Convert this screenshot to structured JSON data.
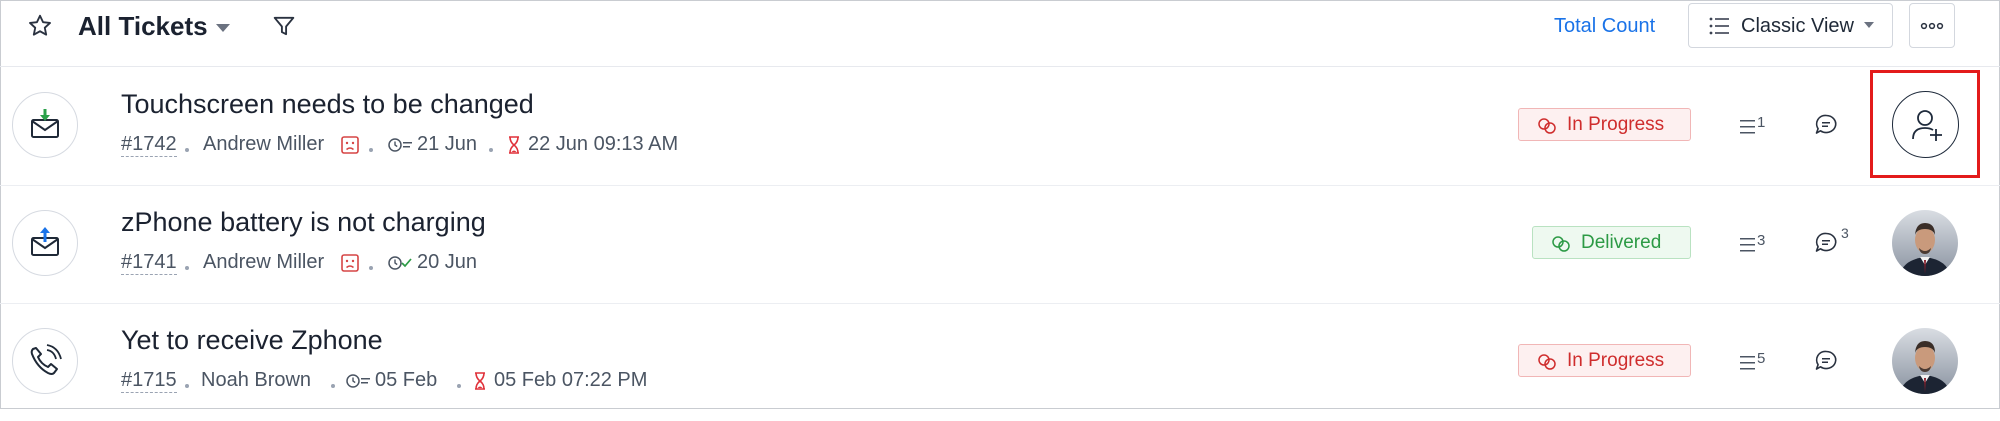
{
  "header": {
    "view_title": "All Tickets",
    "total_count_label": "Total Count",
    "view_mode_label": "Classic View"
  },
  "colors": {
    "link_blue": "#1a73e8",
    "in_progress_red": "#cf2d2d",
    "delivered_green": "#2c9a45",
    "highlight_red": "#e31b1b"
  },
  "tickets": [
    {
      "channel_icon": "email-incoming-icon",
      "subject": "Touchscreen needs to be changed",
      "number": "#1742",
      "contact": "Andrew Miller",
      "sentiment_icon": "sad-face-icon",
      "created": "21 Jun",
      "due": "22 Jun 09:13 AM",
      "status": "In Progress",
      "thread_count": "1",
      "comment_count": "",
      "assignee": "unassigned"
    },
    {
      "channel_icon": "email-outgoing-icon",
      "subject": "zPhone battery is not charging",
      "number": "#1741",
      "contact": "Andrew Miller",
      "sentiment_icon": "sad-face-icon",
      "created": "20 Jun",
      "status": "Delivered",
      "thread_count": "3",
      "comment_count": "3",
      "assignee": "avatar"
    },
    {
      "channel_icon": "phone-call-icon",
      "subject": "Yet to receive Zphone",
      "number": "#1715",
      "contact": "Noah Brown",
      "created": "05 Feb",
      "due": "05 Feb 07:22 PM",
      "status": "In Progress",
      "thread_count": "5",
      "comment_count": "",
      "assignee": "avatar"
    }
  ]
}
